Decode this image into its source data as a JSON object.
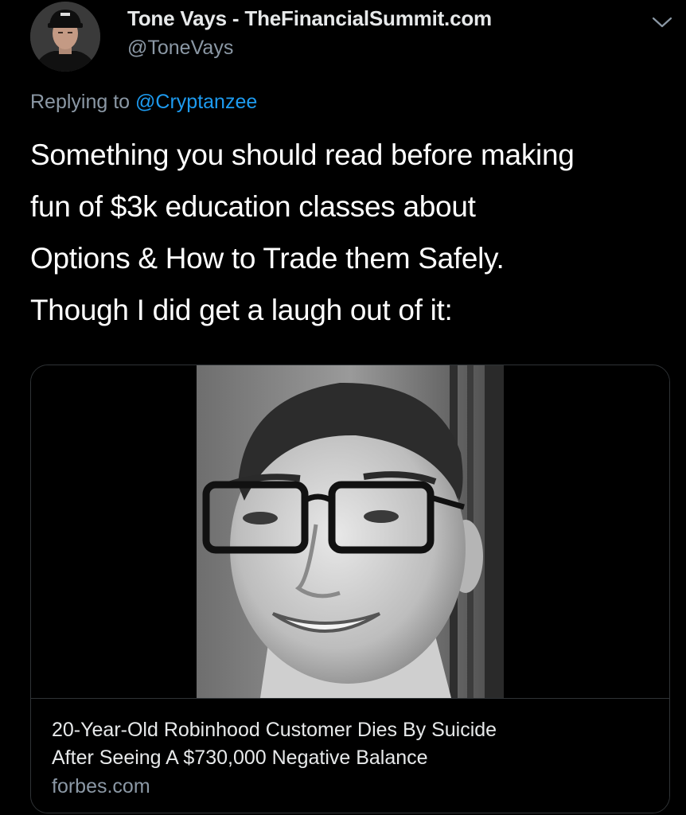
{
  "tweet": {
    "author_name": "Tone Vays - TheFinancialSummit.com",
    "author_handle": "@ToneVays",
    "replying_prefix": "Replying to ",
    "replying_to": "@Cryptanzee",
    "text_lines": [
      "Something you should read before making",
      "fun of $3k education classes about",
      "Options & How to Trade them Safely.",
      "Though I did get a laugh out of it:"
    ],
    "avatar_icon": "profile-photo",
    "menu_icon": "chevron-down-icon"
  },
  "card": {
    "image_icon": "article-photo",
    "title_lines": [
      "20-Year-Old Robinhood Customer Dies By Suicide",
      "After Seeing A $730,000 Negative Balance"
    ],
    "domain": "forbes.com"
  },
  "colors": {
    "background": "#000000",
    "primary_text": "#e7e9ea",
    "secondary_text": "#8b98a5",
    "link": "#1d9bf0",
    "border": "#2f3336"
  }
}
